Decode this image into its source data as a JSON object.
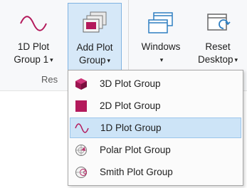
{
  "ribbon": {
    "buttons": [
      {
        "line1": "1D Plot",
        "line2": "Group 1",
        "arrow": "▾"
      },
      {
        "line1": "Add Plot",
        "line2": "Group",
        "arrow": "▾"
      },
      {
        "line1": "Windows",
        "line2": "",
        "arrow": "▾"
      },
      {
        "line1": "Reset",
        "line2": "Desktop",
        "arrow": "▾"
      }
    ],
    "group_label": "Res"
  },
  "menu": {
    "items": [
      {
        "label": "3D Plot Group",
        "icon": "cube-icon"
      },
      {
        "label": "2D Plot Group",
        "icon": "square-icon"
      },
      {
        "label": "1D Plot Group",
        "icon": "sine-wave-icon"
      },
      {
        "label": "Polar Plot Group",
        "icon": "polar-icon"
      },
      {
        "label": "Smith Plot Group",
        "icon": "smith-chart-icon"
      }
    ],
    "highlighted": "1D Plot Group"
  },
  "colors": {
    "accent": "#b3195b",
    "icon_blue": "#2f7fc1",
    "highlight": "#cde4f7"
  }
}
